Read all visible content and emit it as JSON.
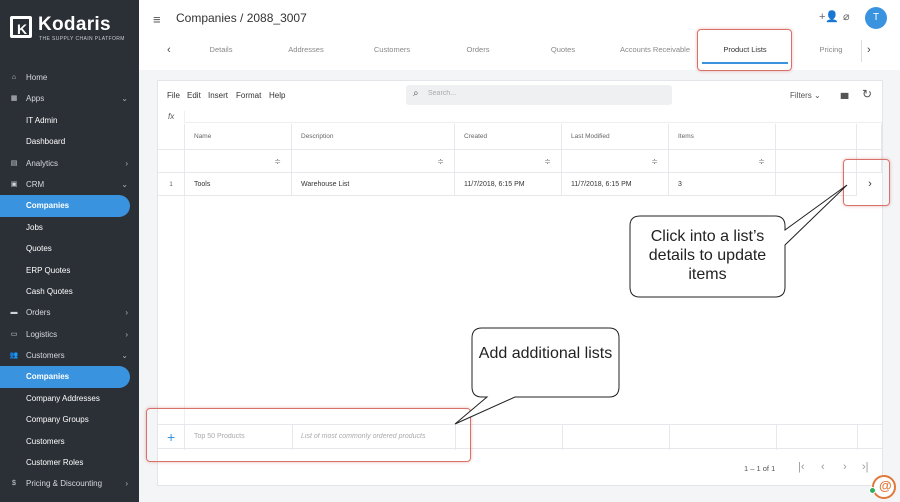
{
  "brand": {
    "name": "Kodaris",
    "tagline": "THE SUPPLY CHAIN PLATFORM",
    "mark": "K"
  },
  "sidebar": {
    "items": [
      {
        "label": "Home",
        "icon": "home-icon",
        "glyph": "⌂",
        "chevron": ""
      },
      {
        "label": "Apps",
        "icon": "apps-icon",
        "glyph": "▦",
        "chevron": "⌄"
      },
      {
        "label": "IT Admin"
      },
      {
        "label": "Dashboard"
      },
      {
        "label": "Analytics",
        "icon": "analytics-icon",
        "glyph": "▤",
        "chevron": "›"
      },
      {
        "label": "CRM",
        "icon": "crm-icon",
        "glyph": "▣",
        "chevron": "⌄"
      },
      {
        "label": "Companies"
      },
      {
        "label": "Jobs"
      },
      {
        "label": "Quotes"
      },
      {
        "label": "ERP Quotes"
      },
      {
        "label": "Cash Quotes"
      },
      {
        "label": "Orders",
        "icon": "truck-icon",
        "glyph": "▬",
        "chevron": "›"
      },
      {
        "label": "Logistics",
        "icon": "logistics-icon",
        "glyph": "▭",
        "chevron": "›"
      },
      {
        "label": "Customers",
        "icon": "customers-icon",
        "glyph": "👥",
        "chevron": "⌄"
      },
      {
        "label": "Companies"
      },
      {
        "label": "Company Addresses"
      },
      {
        "label": "Company Groups"
      },
      {
        "label": "Customers"
      },
      {
        "label": "Customer Roles"
      },
      {
        "label": "Pricing & Discounting",
        "icon": "dollar-icon",
        "glyph": "$",
        "chevron": "›"
      }
    ]
  },
  "header": {
    "title": "Companies / 2088_3007",
    "avatar_initial": "T",
    "icons": {
      "add_person": "+👤",
      "attach": "⌀"
    }
  },
  "tabs": [
    {
      "label": "Details"
    },
    {
      "label": "Addresses"
    },
    {
      "label": "Customers"
    },
    {
      "label": "Orders"
    },
    {
      "label": "Quotes"
    },
    {
      "label": "Accounts Receivable"
    },
    {
      "label": "Product Lists"
    },
    {
      "label": "Pricing"
    }
  ],
  "toolbar": {
    "menus": [
      "File",
      "Edit",
      "Insert",
      "Format",
      "Help"
    ],
    "search_placeholder": "Search...",
    "filters_label": "Filters",
    "filters_chevron": "⌄",
    "columns_glyph": "▮▮▮",
    "refresh_glyph": "↻"
  },
  "formula_label": "fx",
  "grid": {
    "columns": [
      "Name",
      "Description",
      "Created",
      "Last Modified",
      "Items"
    ],
    "filter_glyph": "≑",
    "rows": [
      {
        "num": "1",
        "name": "Tools",
        "description": "Warehouse List",
        "created": "11/7/2018, 6:15 PM",
        "modified": "11/7/2018, 6:15 PM",
        "items": "3"
      }
    ],
    "detail_glyph": "›",
    "add_row": {
      "plus": "+",
      "name_placeholder": "Top 50 Products",
      "description_placeholder": "List of most commonly ordered products"
    }
  },
  "pagination": {
    "label": "1 – 1 of 1",
    "first": "|‹",
    "prev": "‹",
    "next": "›",
    "last": "›|"
  },
  "callouts": {
    "details": "Click into a list’s details to update items",
    "add": "Add additional lists"
  },
  "colors": {
    "accent": "#3a93df",
    "sidebar": "#2b2f36",
    "highlight": "#d9716b"
  }
}
